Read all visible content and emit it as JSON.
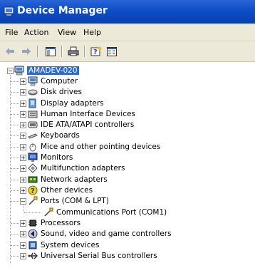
{
  "window": {
    "title": "Device Manager"
  },
  "menu": {
    "file": "File",
    "action": "Action",
    "view": "View",
    "help": "Help"
  },
  "toolbar": {
    "back_icon": "back-arrow-icon",
    "forward_icon": "forward-arrow-icon",
    "show_hide_tree_icon": "console-tree-icon",
    "print_icon": "print-icon",
    "help_icon": "help-icon",
    "properties_icon": "properties-icon"
  },
  "tree": {
    "root": "AMADEV-020",
    "items": [
      {
        "label": "Computer",
        "icon": "computer-icon"
      },
      {
        "label": "Disk drives",
        "icon": "disk-drive-icon"
      },
      {
        "label": "Display adapters",
        "icon": "display-adapter-icon"
      },
      {
        "label": "Human Interface Devices",
        "icon": "hid-icon"
      },
      {
        "label": "IDE ATA/ATAPI controllers",
        "icon": "ide-controller-icon"
      },
      {
        "label": "Keyboards",
        "icon": "keyboard-icon"
      },
      {
        "label": "Mice and other pointing devices",
        "icon": "mouse-icon"
      },
      {
        "label": "Monitors",
        "icon": "monitor-icon"
      },
      {
        "label": "Multifunction adapters",
        "icon": "multifunction-icon"
      },
      {
        "label": "Network adapters",
        "icon": "network-adapter-icon"
      },
      {
        "label": "Other devices",
        "icon": "unknown-device-icon"
      },
      {
        "label": "Ports (COM & LPT)",
        "icon": "port-icon",
        "expanded": true,
        "children": [
          {
            "label": "Communications Port (COM1)",
            "icon": "port-icon"
          }
        ]
      },
      {
        "label": "Processors",
        "icon": "processor-icon"
      },
      {
        "label": "Sound, video and game controllers",
        "icon": "sound-icon"
      },
      {
        "label": "System devices",
        "icon": "system-device-icon"
      },
      {
        "label": "Universal Serial Bus controllers",
        "icon": "usb-icon"
      }
    ]
  }
}
